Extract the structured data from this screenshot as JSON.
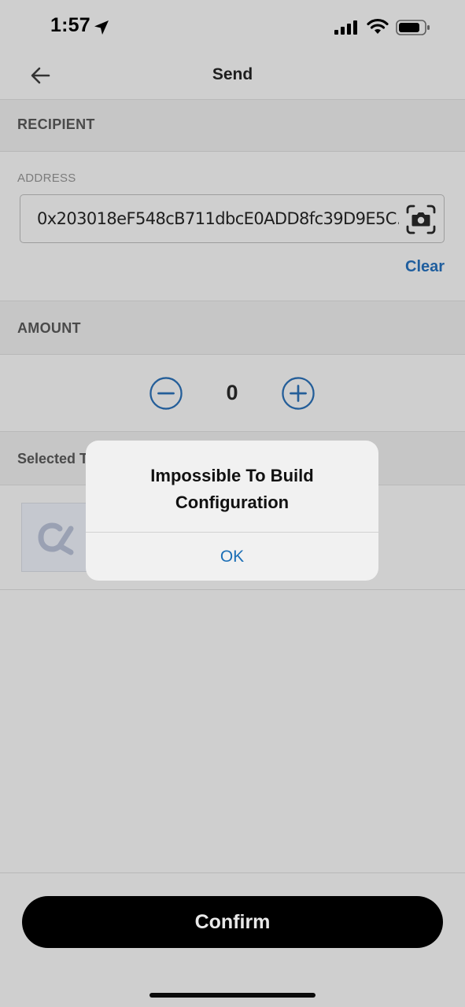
{
  "status_bar": {
    "time": "1:57",
    "icons": [
      "location-arrow-icon",
      "cellular-signal-icon",
      "wifi-icon",
      "battery-icon"
    ]
  },
  "header": {
    "title": "Send",
    "back_icon": "arrow-left-icon"
  },
  "recipient": {
    "section_title": "RECIPIENT",
    "address_label": "ADDRESS",
    "address_value": "0x203018eF548cB711dbcE0ADD8fc39D9E5C…",
    "camera_icon": "camera-scan-icon",
    "clear_label": "Clear"
  },
  "amount": {
    "section_title": "AMOUNT",
    "value": "0",
    "decrement_icon": "minus-circle-icon",
    "increment_icon": "plus-circle-icon"
  },
  "selected_token": {
    "section_title": "Selected T",
    "logo_icon": "token-logo-icon"
  },
  "alert": {
    "title_line1": "Impossible To Build",
    "title_line2": "Configuration",
    "ok_label": "OK"
  },
  "footer": {
    "confirm_label": "Confirm"
  },
  "colors": {
    "accent_blue": "#1f5e9e",
    "dimmed_background": "#cfcfcf",
    "confirm_button": "#000000",
    "alert_background": "#f1f1f1"
  }
}
